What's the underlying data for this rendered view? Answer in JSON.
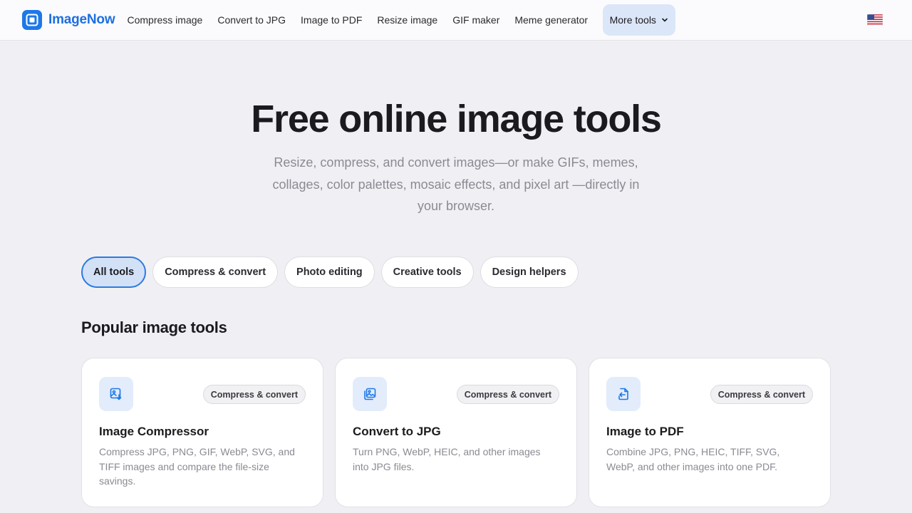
{
  "header": {
    "brand": "ImageNow",
    "nav": [
      "Compress image",
      "Convert to JPG",
      "Image to PDF",
      "Resize image",
      "GIF maker",
      "Meme generator"
    ],
    "more_label": "More tools",
    "language_icon": "us-flag-icon"
  },
  "hero": {
    "title": "Free online image tools",
    "subtitle": "Resize, compress, and convert images—or make GIFs, memes, collages, color palettes, mosaic effects, and pixel art —directly in your browser."
  },
  "filters": {
    "items": [
      "All tools",
      "Compress & convert",
      "Photo editing",
      "Creative tools",
      "Design helpers"
    ],
    "active": "All tools"
  },
  "section": {
    "title": "Popular image tools"
  },
  "cards": [
    {
      "icon": "image-compress-icon",
      "badge": "Compress & convert",
      "title": "Image Compressor",
      "description": "Compress JPG, PNG, GIF, WebP, SVG, and TIFF images and compare the file-size savings."
    },
    {
      "icon": "images-convert-icon",
      "badge": "Compress & convert",
      "title": "Convert to JPG",
      "description": "Turn PNG, WebP, HEIC, and other images into JPG files."
    },
    {
      "icon": "file-pdf-icon",
      "badge": "Compress & convert",
      "title": "Image to PDF",
      "description": "Combine JPG, PNG, HEIC, TIFF, SVG, WebP, and other images into one PDF."
    }
  ],
  "colors": {
    "accent": "#1e78e8",
    "background": "#f0f0f4",
    "muted_text": "#8a8a93"
  }
}
